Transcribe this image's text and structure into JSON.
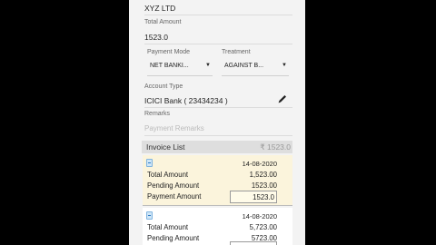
{
  "form": {
    "company": "XYZ LTD",
    "total_amount_label": "Total Amount",
    "total_amount_value": "1523.0",
    "payment_mode_label": "Payment Mode",
    "payment_mode_value": "NET BANKI...",
    "treatment_label": "Treatment",
    "treatment_value": "AGAINST B...",
    "account_type_label": "Account Type",
    "account_type_value": "ICICI Bank ( 23434234 )",
    "remarks_label": "Remarks",
    "remarks_placeholder": "Payment Remarks"
  },
  "invoice_list": {
    "title": "Invoice List",
    "total": "₹ 1523.0",
    "cards": [
      {
        "date": "14-08-2020",
        "total_amount_label": "Total Amount",
        "total_amount": "1,523.00",
        "pending_amount_label": "Pending Amount",
        "pending_amount": "1523.00",
        "payment_amount_label": "Payment Amount",
        "payment_amount": "1523.0"
      },
      {
        "date": "14-08-2020",
        "total_amount_label": "Total Amount",
        "total_amount": "5,723.00",
        "pending_amount_label": "Pending Amount",
        "pending_amount": "5723.00"
      }
    ]
  },
  "icons": {
    "edit": "pencil-icon",
    "invoice": "document-icon",
    "dropdown": "chevron-down-icon"
  },
  "colors": {
    "selected_card": "#fbf4dc",
    "header_bar": "#dedede"
  }
}
